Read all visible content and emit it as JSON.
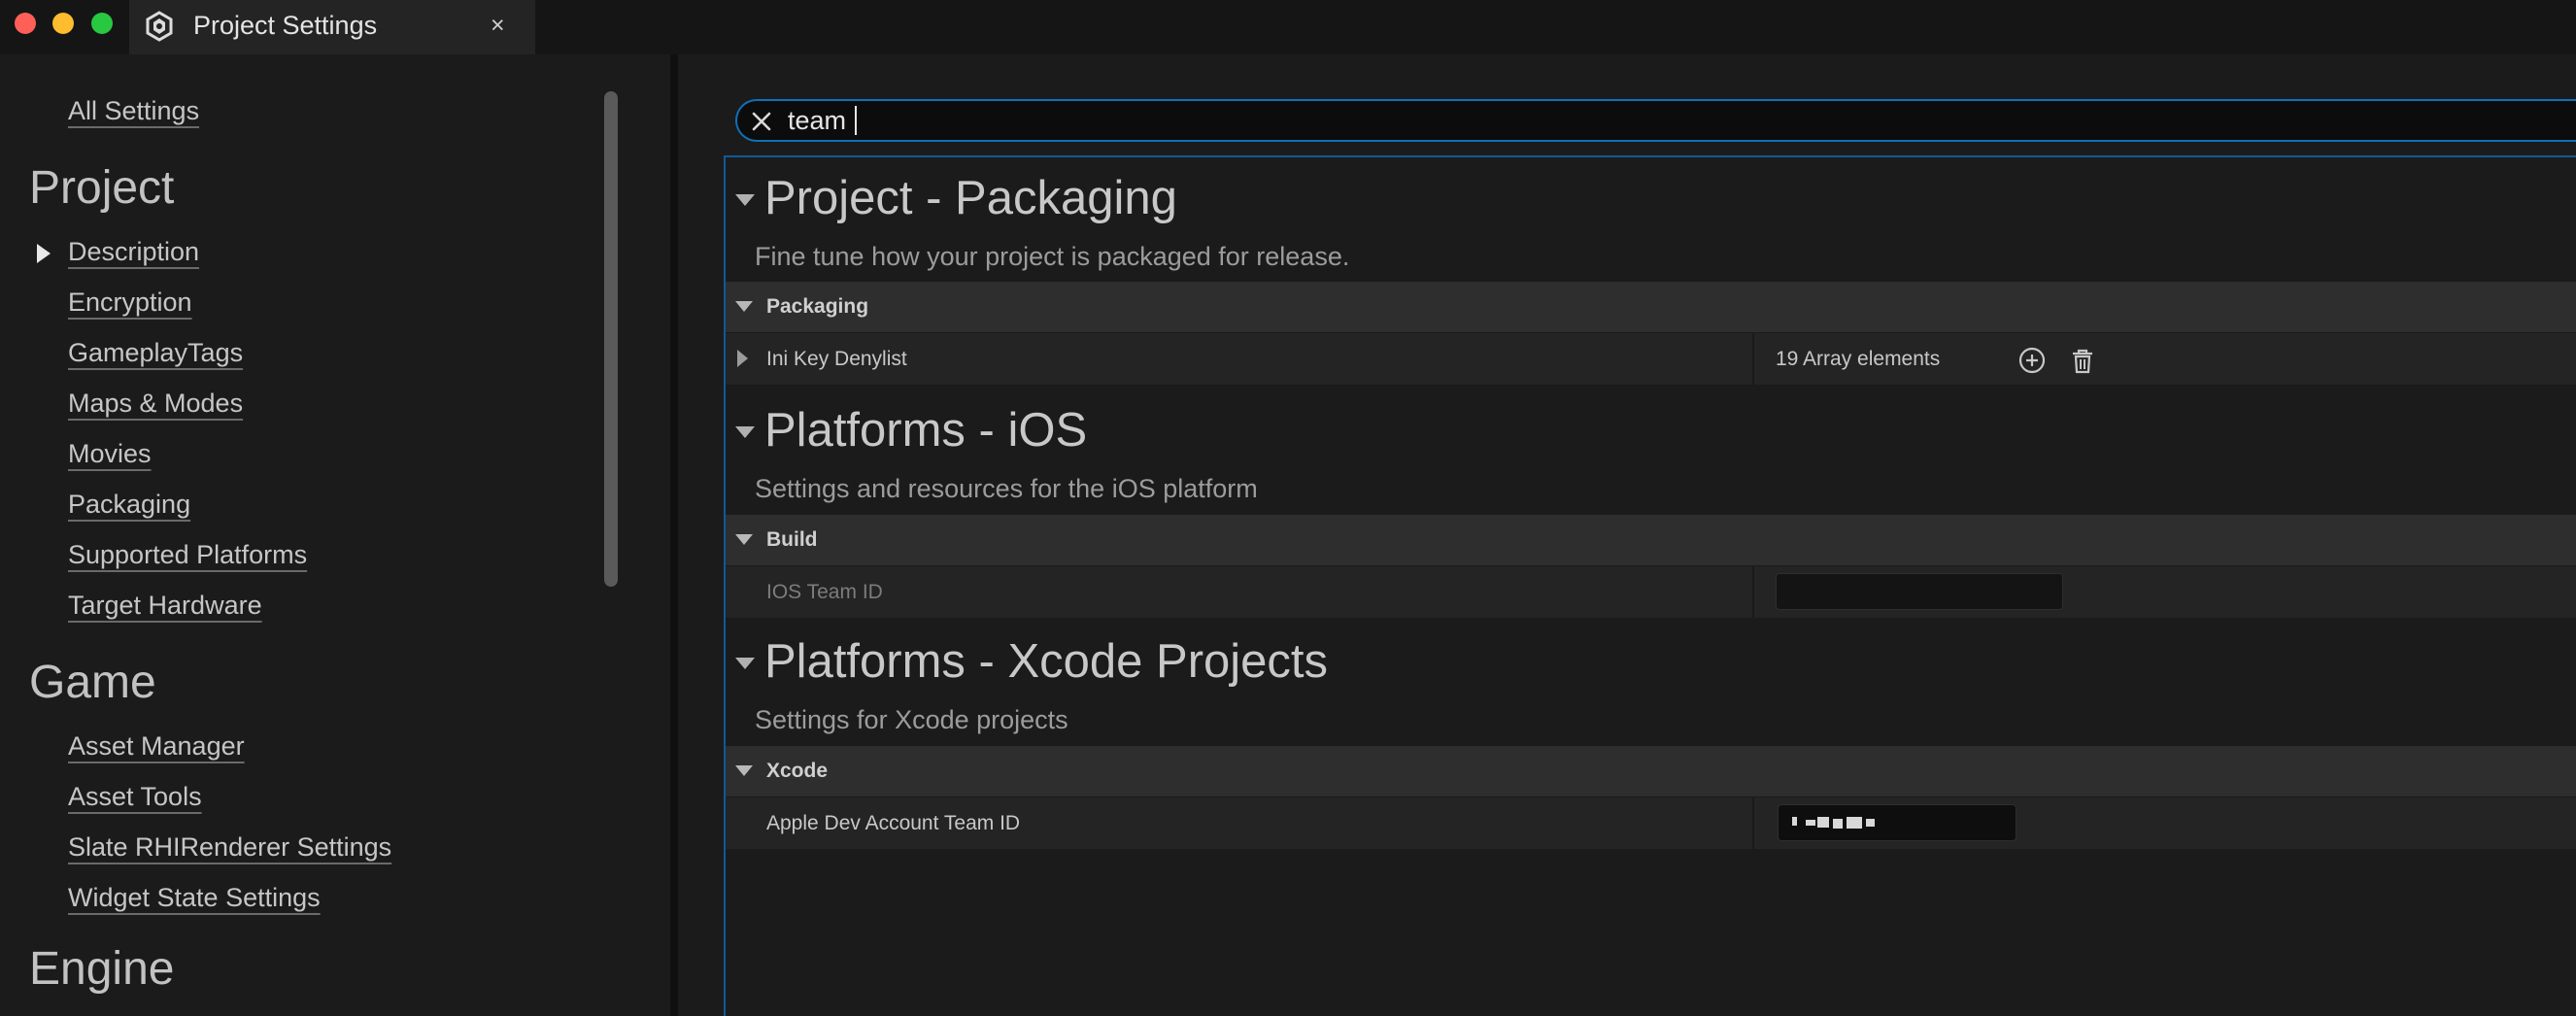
{
  "window": {
    "tab_title": "Project Settings",
    "tab_close": "×",
    "tab_icon": "unreal-settings-icon"
  },
  "sidebar": {
    "all_settings": "All Settings",
    "project_heading": "Project",
    "project_items": [
      "Description",
      "Encryption",
      "GameplayTags",
      "Maps & Modes",
      "Movies",
      "Packaging",
      "Supported Platforms",
      "Target Hardware"
    ],
    "game_heading": "Game",
    "game_items": [
      "Asset Manager",
      "Asset Tools",
      "Slate RHIRenderer Settings",
      "Widget State Settings"
    ],
    "engine_heading": "Engine"
  },
  "search": {
    "value": "team",
    "clear_icon": "close-icon"
  },
  "sections": [
    {
      "title": "Project - Packaging",
      "description": "Fine tune how your project is packaged for release.",
      "category": "Packaging",
      "row_label": "Ini Key Denylist",
      "row_value": "19 Array elements",
      "row_icons": [
        "add-circle-icon",
        "trash-icon"
      ]
    },
    {
      "title": "Platforms - iOS",
      "description": "Settings and resources for the iOS platform",
      "category": "Build",
      "row_label": "IOS Team ID",
      "row_value": ""
    },
    {
      "title": "Platforms - Xcode Projects",
      "description": "Settings for Xcode projects",
      "category": "Xcode",
      "row_label": "Apple Dev Account Team ID",
      "row_value": "[redacted]"
    }
  ],
  "colors": {
    "accent": "#0f6fb8",
    "background": "#1b1b1b",
    "category_bar": "#2e2e2e",
    "row": "#242424"
  }
}
